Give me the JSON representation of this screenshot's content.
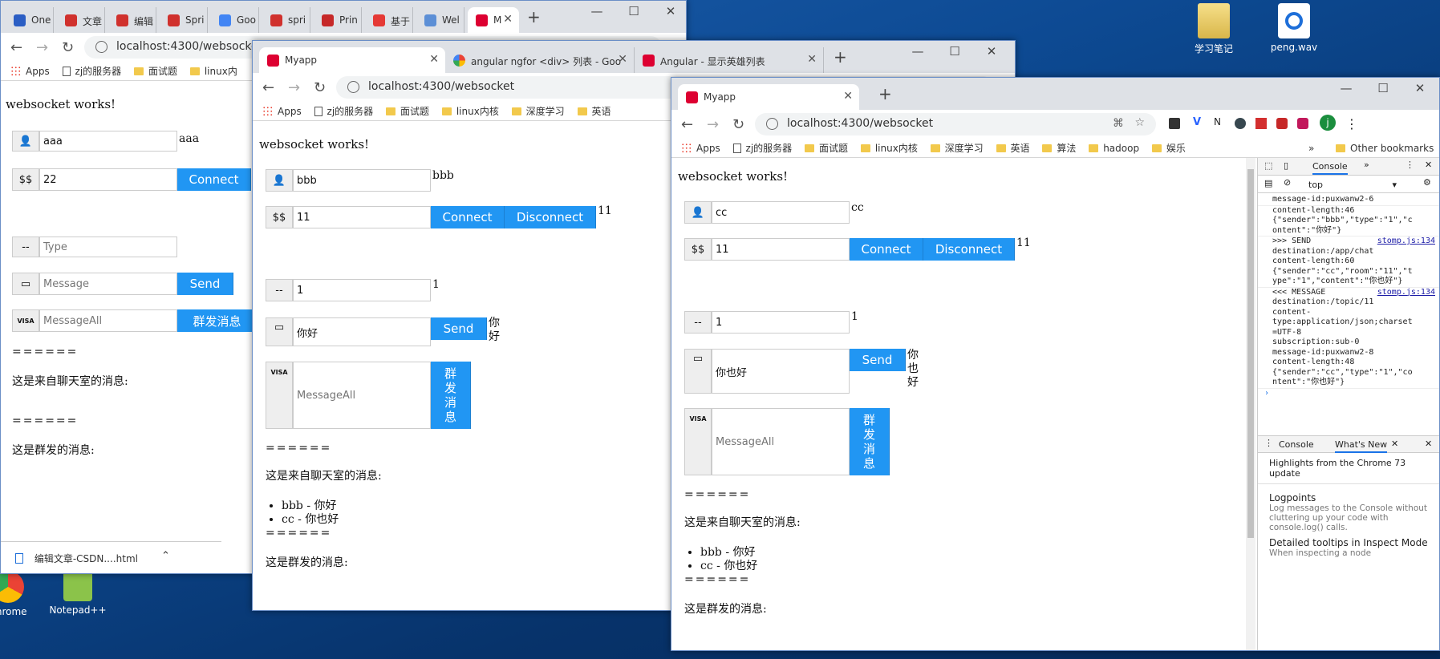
{
  "desktop": {
    "icons": [
      {
        "label": "学习笔记"
      },
      {
        "label": "peng.wav"
      },
      {
        "label": "Chrome"
      },
      {
        "label": "Notepad++"
      }
    ]
  },
  "window1": {
    "tabs": [
      "One",
      "文章",
      "编辑",
      "Spri",
      "Goo",
      "spri",
      "Prin",
      "基于",
      "Wel",
      "M"
    ],
    "url": "localhost:4300/websocket",
    "bookmarks": [
      "Apps",
      "zj的服务器",
      "面试题",
      "linux内"
    ],
    "heading": "websocket works!",
    "name_value": "aaa",
    "name_echo": "aaa",
    "room_addon": "$$",
    "room_value": "22",
    "connect_label": "Connect",
    "type_addon": "--",
    "type_placeholder": "Type",
    "message_placeholder": "Message",
    "send_label": "Send",
    "messageall_placeholder": "MessageAll",
    "broadcast_label": "群发消息",
    "divider1": "======",
    "chat_caption": "这是来自聊天室的消息:",
    "divider2": "======",
    "broadcast_caption": "这是群发的消息:",
    "download_file": "编辑文章-CSDN....html"
  },
  "window2": {
    "tabs": [
      "Myapp",
      "angular ngfor <div> 列表 - Goo",
      "Angular - 显示英雄列表"
    ],
    "url": "localhost:4300/websocket",
    "bookmarks": [
      "Apps",
      "zj的服务器",
      "面试题",
      "linux内核",
      "深度学习",
      "英语"
    ],
    "heading": "websocket works!",
    "name_value": "bbb",
    "name_echo": "bbb",
    "room_addon": "$$",
    "room_value": "11",
    "room_echo": "11",
    "connect_label": "Connect",
    "disconnect_label": "Disconnect",
    "type_addon": "--",
    "type_value": "1",
    "type_echo": "1",
    "message_value": "你好",
    "send_label": "Send",
    "send_echo": "你好",
    "messageall_placeholder": "MessageAll",
    "broadcast_label": "群发消息",
    "divider1": "======",
    "chat_caption": "这是来自聊天室的消息:",
    "messages": [
      "bbb - 你好",
      "cc - 你也好"
    ],
    "divider2": "======",
    "broadcast_caption": "这是群发的消息:"
  },
  "window3": {
    "tabs": [
      "Myapp"
    ],
    "url": "localhost:4300/websocket",
    "bookmarks": [
      "Apps",
      "zj的服务器",
      "面试题",
      "linux内核",
      "深度学习",
      "英语",
      "算法",
      "hadoop",
      "娱乐"
    ],
    "other_bookmarks": "Other bookmarks",
    "heading": "websocket works!",
    "name_value": "cc",
    "name_echo": "cc",
    "room_addon": "$$",
    "room_value": "11",
    "room_echo": "11",
    "connect_label": "Connect",
    "disconnect_label": "Disconnect",
    "type_addon": "--",
    "type_value": "1",
    "type_echo": "1",
    "message_value": "你也好",
    "send_label": "Send",
    "send_echo": "你也好",
    "messageall_placeholder": "MessageAll",
    "broadcast_label": "群发消息",
    "divider1": "======",
    "chat_caption": "这是来自聊天室的消息:",
    "messages": [
      "bbb - 你好",
      "cc - 你也好"
    ],
    "divider2": "======",
    "broadcast_caption": "这是群发的消息:"
  },
  "devtools": {
    "tab_console": "Console",
    "context": "top",
    "log_lines": [
      "message-id:puxwanw2-6",
      "content-length:46",
      "",
      "{\"sender\":\"bbb\",\"type\":\"1\",\"c",
      "ontent\":\"你好\"}",
      ">>> SEND",
      "destination:/app/chat",
      "content-length:60",
      "",
      "{\"sender\":\"cc\",\"room\":\"11\",\"t",
      "ype\":\"1\",\"content\":\"你也好\"}",
      "<<< MESSAGE",
      "destination:/topic/11",
      "content-",
      "type:application/json;charset",
      "=UTF-8",
      "subscription:sub-0",
      "message-id:puxwanw2-8",
      "content-length:48",
      "",
      "{\"sender\":\"cc\",\"type\":\"1\",\"co",
      "ntent\":\"你也好\"}"
    ],
    "source_link": "stomp.js:134",
    "drawer_tab_console": "Console",
    "drawer_tab_whatsnew": "What's New",
    "highlights": "Highlights from the Chrome 73 update",
    "item1_title": "Logpoints",
    "item1_desc": "Log messages to the Console without cluttering up your code with console.log() calls.",
    "item2_title": "Detailed tooltips in Inspect Mode",
    "item2_desc": "When inspecting a node"
  }
}
